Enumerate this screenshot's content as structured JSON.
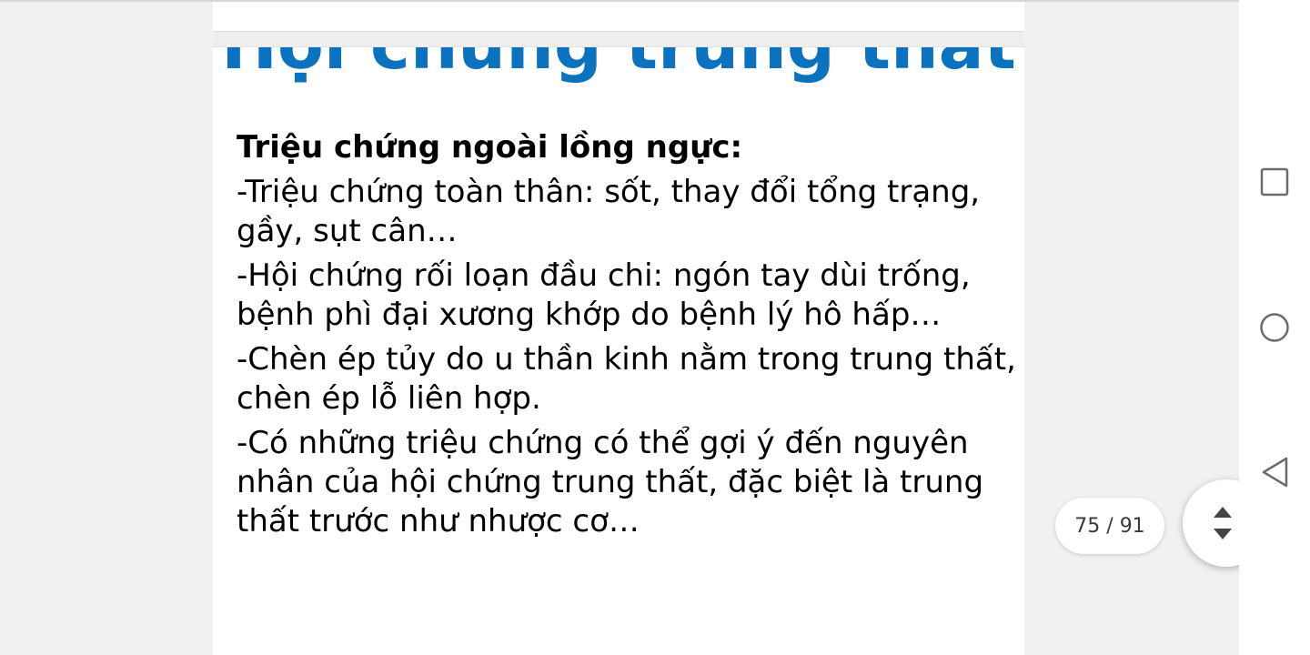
{
  "slide": {
    "title": "Hội chứng trung thất",
    "heading": "Triệu chứng ngoài lồng ngực:",
    "paragraphs": [
      "-Triệu chứng toàn thân: sốt, thay đổi tổng trạng, gầy, sụt cân…",
      "-Hội chứng rối loạn đầu chi: ngón tay dùi trống, bệnh phì đại xương khớp do bệnh lý hô hấp…",
      "-Chèn ép tủy do u thần kinh nằm trong trung thất, chèn ép lỗ liên hợp.",
      "-Có những triệu chứng có thể gợi ý đến nguyên nhân của hội chứng trung thất, đặc biệt là trung thất trước như nhược cơ…"
    ]
  },
  "viewer": {
    "page_indicator": "75 / 91",
    "scroll_fab_icon": "scroll-up-down-icon"
  },
  "navigation_bar": {
    "buttons": [
      {
        "name": "recents",
        "icon": "square-icon"
      },
      {
        "name": "home",
        "icon": "circle-icon"
      },
      {
        "name": "back",
        "icon": "triangle-back-icon"
      }
    ]
  },
  "colors": {
    "title": "#0b72c0",
    "body_text": "#000000",
    "viewer_background": "#f1f1f1",
    "page_background": "#ffffff"
  }
}
